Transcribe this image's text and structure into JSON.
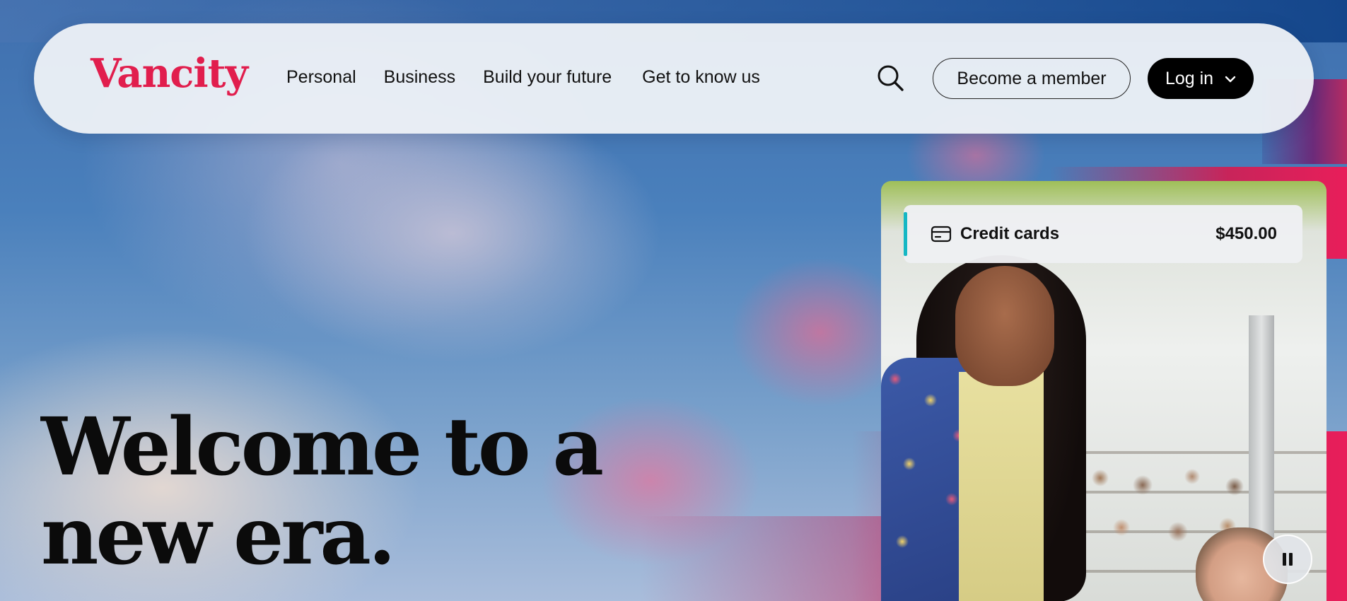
{
  "brand": {
    "logo_text": "Vancity",
    "logo_color": "#e11e4d"
  },
  "nav": {
    "items": [
      {
        "label": "Personal"
      },
      {
        "label": "Business"
      },
      {
        "label": "Build your future"
      },
      {
        "label": "Get to know us"
      }
    ]
  },
  "actions": {
    "search_icon": "search-icon",
    "become_member_label": "Become a member",
    "login_label": "Log in",
    "login_icon": "chevron-down-icon"
  },
  "hero": {
    "title_line_1": "Welcome to a",
    "title_line_2": "new era."
  },
  "media_card": {
    "label": "Credit cards",
    "amount": "$450.00",
    "icon": "credit-card-icon",
    "accent_color": "#15b7c4"
  },
  "video_control": {
    "icon": "pause-icon"
  }
}
